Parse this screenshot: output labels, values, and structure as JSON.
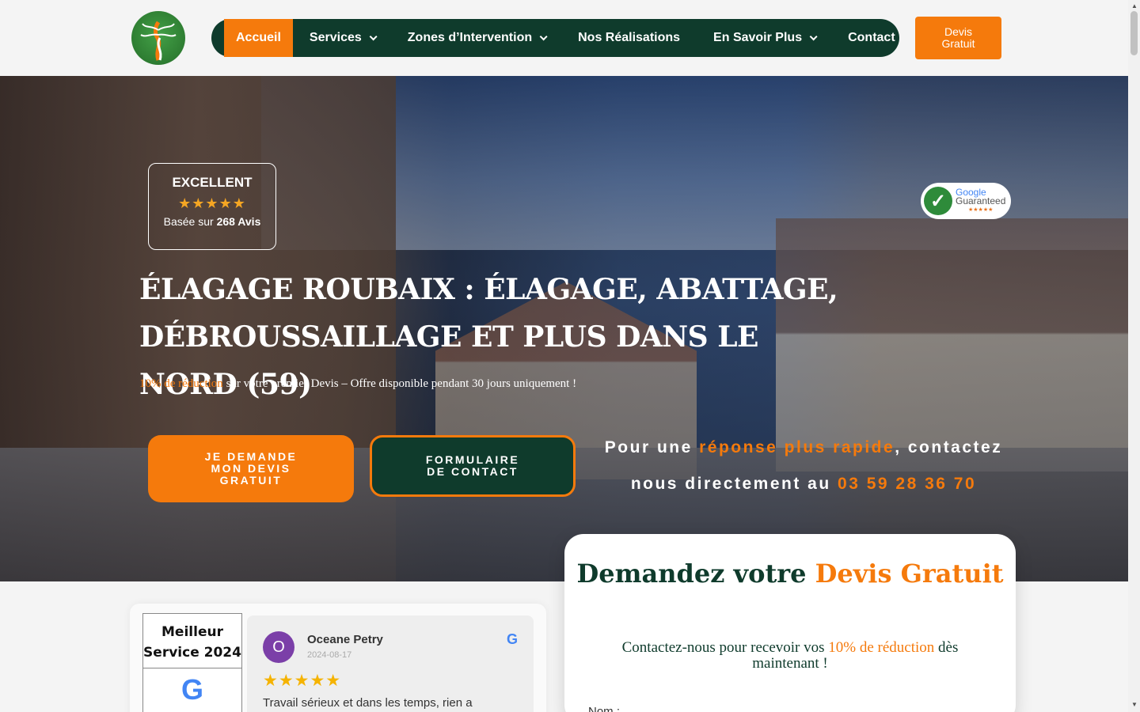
{
  "header": {
    "nav": [
      {
        "label": "Accueil",
        "active": true,
        "dropdown": false
      },
      {
        "label": "Services",
        "active": false,
        "dropdown": true
      },
      {
        "label": "Zones d’Intervention",
        "active": false,
        "dropdown": true
      },
      {
        "label": "Nos Réalisations",
        "active": false,
        "dropdown": false
      },
      {
        "label": "En Savoir Plus",
        "active": false,
        "dropdown": true
      },
      {
        "label": "Contact",
        "active": false,
        "dropdown": false
      }
    ],
    "cta_line1": "Devis",
    "cta_line2": "Gratuit"
  },
  "hero": {
    "rating": {
      "title": "EXCELLENT",
      "stars": "★★★★★",
      "based_on": "Basée sur",
      "count": "268 Avis"
    },
    "google_badge": {
      "line1": "Google",
      "line2": "Guaranteed",
      "stars": "★★★★★"
    },
    "title_line1": "ÉLAGAGE ROUBAIX : ÉLAGAGE, ABATTAGE,",
    "title_line2": "DÉBROUSSAILLAGE ET PLUS DANS LE NORD (59)",
    "promo_highlight": "10% de réduction",
    "promo_rest": " sur votre premier Devis – Offre disponible pendant 30 jours uniquement !",
    "btn_quote": [
      "JE DEMANDE",
      "MON DEVIS",
      "GRATUIT"
    ],
    "btn_form": [
      "FORMULAIRE",
      "DE CONTACT"
    ],
    "fast_contact": {
      "part1": "Pour une ",
      "highlight": "réponse plus rapide",
      "part2": ", contactez nous directement au ",
      "phone": "03 59 28 36 70"
    }
  },
  "reviews": {
    "best_service": "Meilleur Service 2024",
    "google_letter": "G",
    "reviewer": {
      "initial": "O",
      "name": "Oceane Petry",
      "date": "2024-08-17",
      "stars": "★★★★★",
      "text": "Travail sérieux et dans les temps, rien a"
    }
  },
  "form": {
    "title_part1": "Demandez votre ",
    "title_highlight": "Devis Gratuit",
    "sub_part1": "Contactez-nous pour recevoir vos ",
    "sub_highlight": "10% de réduction",
    "sub_part2": " dès maintenant !",
    "name_label": "Nom :"
  },
  "colors": {
    "brand_orange": "#f57a0c",
    "brand_green": "#0f3b2c"
  }
}
